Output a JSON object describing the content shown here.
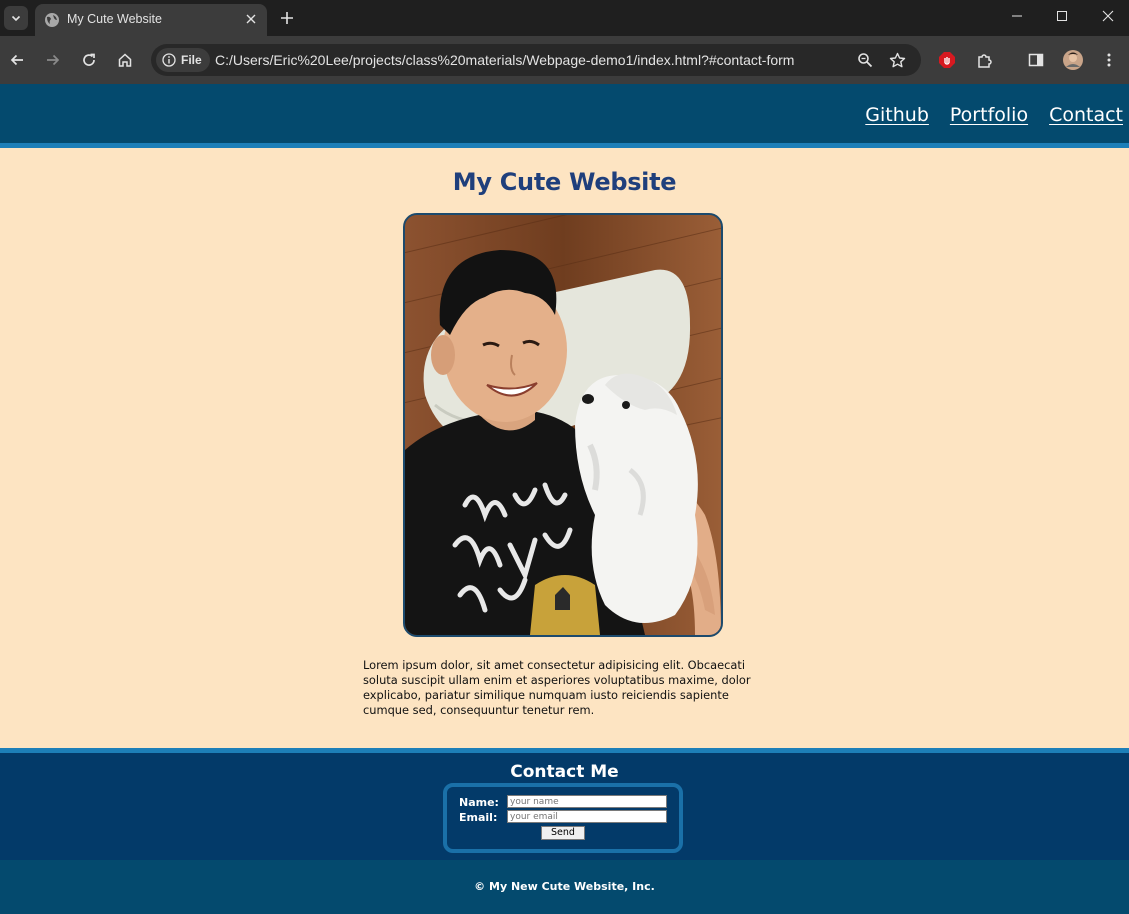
{
  "browser": {
    "tab_title": "My Cute Website",
    "site_chip_label": "File",
    "url": "C:/Users/Eric%20Lee/projects/class%20materials/Webpage-demo1/index.html?#contact-form"
  },
  "site": {
    "nav": [
      "Github",
      "Portfolio",
      "Contact"
    ],
    "title": "My Cute Website",
    "intro": "Lorem ipsum dolor, sit amet consectetur adipisicing elit. Obcaecati soluta suscipit ullam enim et asperiores voluptatibus maxime, dolor explicabo, pariatur similique numquam iusto reiciendis sapiente cumque sed, consequuntur tenetur rem.",
    "contact": {
      "title": "Contact Me",
      "name_label": "Name:",
      "name_placeholder": "your name",
      "email_label": "Email:",
      "email_placeholder": "your email",
      "send_label": "Send"
    },
    "footer": "© My New Cute Website, Inc."
  },
  "colors": {
    "header_bg": "#044a6e",
    "accent_border": "#1d7fb8",
    "page_bg": "#fde4c2",
    "title": "#1f3f7c",
    "contact_bg": "#033a69"
  }
}
